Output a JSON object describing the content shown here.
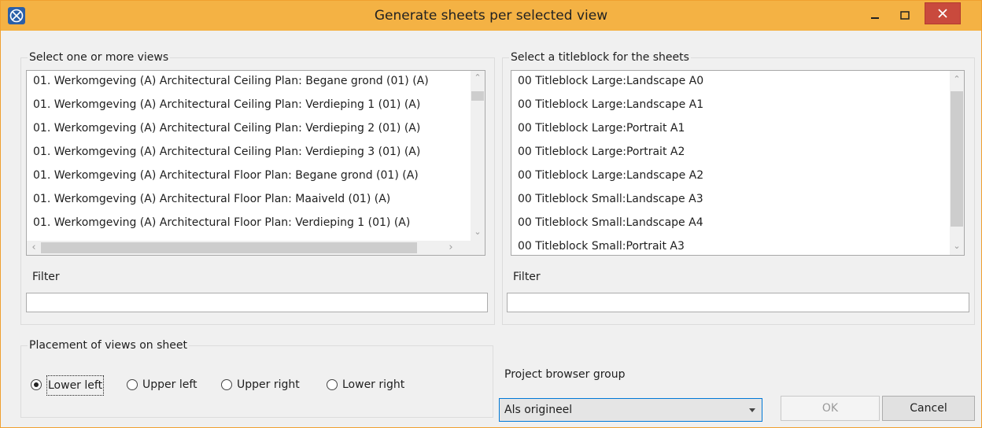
{
  "window": {
    "title": "Generate sheets per selected view"
  },
  "views_group": {
    "label": "Select one or more views",
    "items": [
      "01. Werkomgeving (A) Architectural Ceiling Plan: Begane grond (01) (A)",
      "01. Werkomgeving (A) Architectural Ceiling Plan: Verdieping 1 (01) (A)",
      "01. Werkomgeving (A) Architectural Ceiling Plan: Verdieping 2 (01) (A)",
      "01. Werkomgeving (A) Architectural Ceiling Plan: Verdieping 3 (01) (A)",
      "01. Werkomgeving (A) Architectural Floor Plan: Begane grond (01) (A)",
      "01. Werkomgeving (A) Architectural Floor Plan: Maaiveld (01) (A)",
      "01. Werkomgeving (A) Architectural Floor Plan: Verdieping 1 (01) (A)"
    ],
    "filter_label": "Filter",
    "filter_value": ""
  },
  "titleblock_group": {
    "label": "Select a titleblock for the sheets",
    "items": [
      "00 Titleblock Large:Landscape A0",
      "00 Titleblock Large:Landscape A1",
      "00 Titleblock Large:Portrait A1",
      "00 Titleblock Large:Portrait A2",
      "00 Titleblock Large:Landscape A2",
      "00 Titleblock Small:Landscape A3",
      "00 Titleblock Small:Landscape A4",
      "00 Titleblock Small:Portrait A3"
    ],
    "filter_label": "Filter",
    "filter_value": ""
  },
  "placement_group": {
    "label": "Placement of views on sheet",
    "options": [
      "Lower left",
      "Upper left",
      "Upper right",
      "Lower right"
    ],
    "selected": "Lower left"
  },
  "project_browser": {
    "label": "Project browser group",
    "selected": "Als origineel"
  },
  "buttons": {
    "ok": "OK",
    "cancel": "Cancel"
  },
  "colors": {
    "titlebar": "#f4b244",
    "close": "#c94a3d",
    "accent": "#0078d7"
  }
}
